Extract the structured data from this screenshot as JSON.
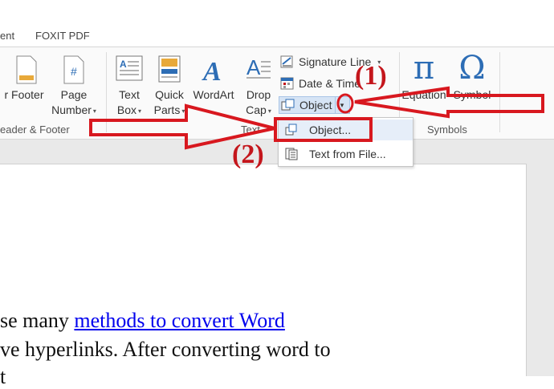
{
  "tabs": [
    "ent",
    "FOXIT PDF"
  ],
  "ribbon": {
    "header_footer": {
      "footer_label": "Footer",
      "footer_prefix": "r",
      "page_number_label_1": "Page",
      "page_number_label_2": "Number",
      "group_label": "eader & Footer"
    },
    "text_group": {
      "text_box_1": "Text",
      "text_box_2": "Box",
      "quick_parts_1": "Quick",
      "quick_parts_2": "Parts",
      "wordart": "WordArt",
      "drop_cap_1": "Drop",
      "drop_cap_2": "Cap",
      "signature_line": "Signature Line",
      "date_time": "Date & Time",
      "object": "Object",
      "group_label": "Text"
    },
    "symbols_group": {
      "equation_glyph": "π",
      "equation": "Equation",
      "symbol_glyph": "Ω",
      "symbol": "Symbol",
      "group_label": "Symbols"
    }
  },
  "dropdown": {
    "items": [
      "Object...",
      "Text from File..."
    ]
  },
  "annotations": {
    "step1": "(1)",
    "step2": "(2)",
    "color": "#c4161c"
  },
  "document": {
    "line1_prefix": "se many ",
    "line1_link": "methods to convert Word",
    "line2": "ve hyperlinks. After converting word to",
    "line3": "t"
  }
}
